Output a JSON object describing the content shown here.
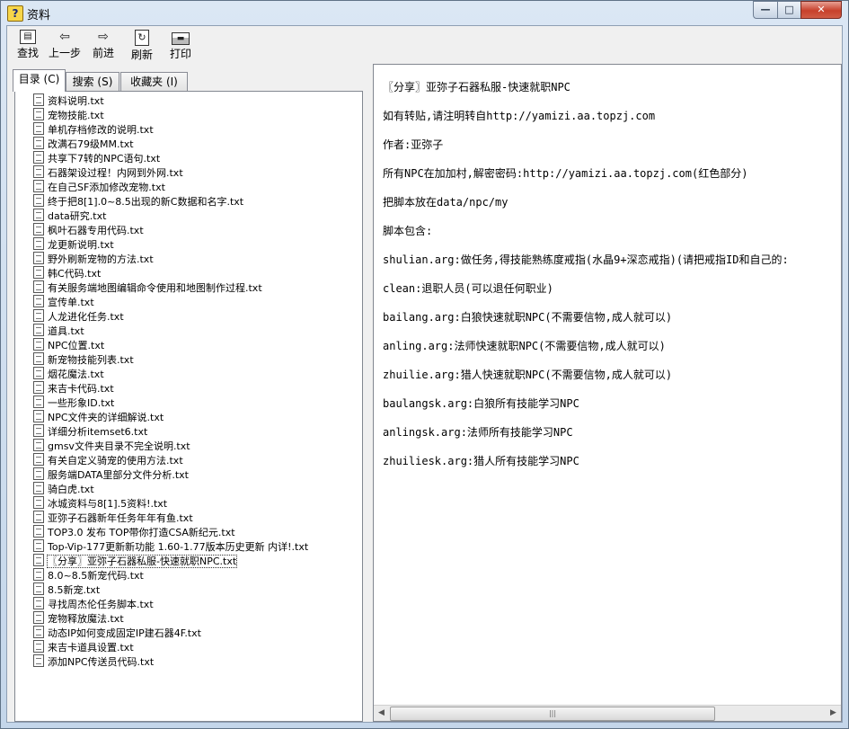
{
  "window": {
    "title": "资料",
    "minimize": "—",
    "maximize": "□",
    "close": "✕"
  },
  "toolbar": [
    {
      "label": "查找",
      "icon": "find-icon",
      "glyph": "▤"
    },
    {
      "label": "上一步",
      "icon": "back-arrow-icon",
      "glyph": "⇦"
    },
    {
      "label": "前进",
      "icon": "forward-arrow-icon",
      "glyph": "⇨"
    },
    {
      "label": "刷新",
      "icon": "refresh-icon",
      "glyph": "↻"
    },
    {
      "label": "打印",
      "icon": "printer-icon",
      "glyph": "▬"
    }
  ],
  "tabs": [
    "目录 (C)",
    "搜索 (S)",
    "收藏夹 (I)"
  ],
  "tree_items": [
    "资料说明.txt",
    "宠物技能.txt",
    "单机存档修改的说明.txt",
    "改满石79级MM.txt",
    "共享下7转的NPC语句.txt",
    "石器架设过程！内网到外网.txt",
    "在自己SF添加修改宠物.txt",
    "终于把8[1].0~8.5出现的新C数据和名字.txt",
    "data研究.txt",
    "枫叶石器专用代码.txt",
    "龙更新说明.txt",
    "野外刷新宠物的方法.txt",
    "韩C代码.txt",
    "有关服务端地图编辑命令使用和地图制作过程.txt",
    "宣传单.txt",
    "人龙进化任务.txt",
    "道具.txt",
    "NPC位置.txt",
    "新宠物技能列表.txt",
    "烟花魔法.txt",
    "来吉卡代码.txt",
    "一些形象ID.txt",
    "NPC文件夹的详细解说.txt",
    "详细分析itemset6.txt",
    "gmsv文件夹目录不完全说明.txt",
    "有关自定义骑宠的使用方法.txt",
    "服务端DATA里部分文件分析.txt",
    "骑白虎.txt",
    "冰城资料与8[1].5资料!.txt",
    "亚弥子石器新年任务年年有鱼.txt",
    "TOP3.0 发布 TOP带你打造CSA新纪元.txt",
    "Top-Vip-177更新新功能 1.60-1.77版本历史更新 内详!.txt",
    "〖分享〗亚弥子石器私服-快速就职NPC.txt",
    "8.0~8.5新宠代码.txt",
    "8.5新宠.txt",
    "寻找周杰伦任务脚本.txt",
    "宠物释放魔法.txt",
    "动态IP如何变成固定IP建石器4F.txt",
    "来吉卡道具设置.txt",
    "添加NPC传送员代码.txt"
  ],
  "selected_item": 32,
  "content_lines": [
    "〖分享〗亚弥子石器私服-快速就职NPC",
    "如有转贴,请注明转自http://yamizi.aa.topzj.com",
    "作者:亚弥子",
    "所有NPC在加加村,解密密码:http://yamizi.aa.topzj.com(红色部分)",
    "把脚本放在data/npc/my",
    "脚本包含:",
    "shulian.arg:做任务,得技能熟练度戒指(水晶9+深恋戒指)(请把戒指ID和自己的:",
    "clean:退职人员(可以退任何职业)",
    "bailang.arg:白狼快速就职NPC(不需要信物,成人就可以)",
    "anling.arg:法师快速就职NPC(不需要信物,成人就可以)",
    "zhuilie.arg:猎人快速就职NPC(不需要信物,成人就可以)",
    "baulangsk.arg:白狼所有技能学习NPC",
    "anlingsk.arg:法师所有技能学习NPC",
    "zhuiliesk.arg:猎人所有技能学习NPC"
  ],
  "scrollbar": {
    "left_arrow": "◀",
    "right_arrow": "▶",
    "grip": "|||"
  }
}
